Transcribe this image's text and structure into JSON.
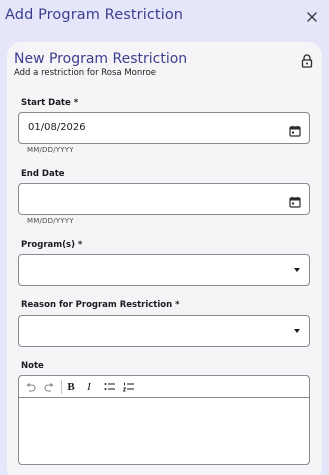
{
  "dialog": {
    "title": "Add Program Restriction"
  },
  "card": {
    "title": "New Program Restriction",
    "subtitle": "Add a restriction for Rosa Monroe"
  },
  "fields": {
    "start_date": {
      "label": "Start Date *",
      "value": "01/08/2026",
      "helper": "MM/DD/YYYY"
    },
    "end_date": {
      "label": "End Date",
      "value": "",
      "helper": "MM/DD/YYYY"
    },
    "programs": {
      "label": "Program(s) *",
      "value": ""
    },
    "reason": {
      "label": "Reason for Program Restriction *",
      "value": ""
    },
    "note": {
      "label": "Note",
      "value": ""
    }
  },
  "toolbar": {
    "bold": "B",
    "italic": "I"
  },
  "colors": {
    "background": "#e6e6fb",
    "title": "#3b3f8f",
    "card": "#f7f4f7",
    "border": "#8a8790"
  }
}
